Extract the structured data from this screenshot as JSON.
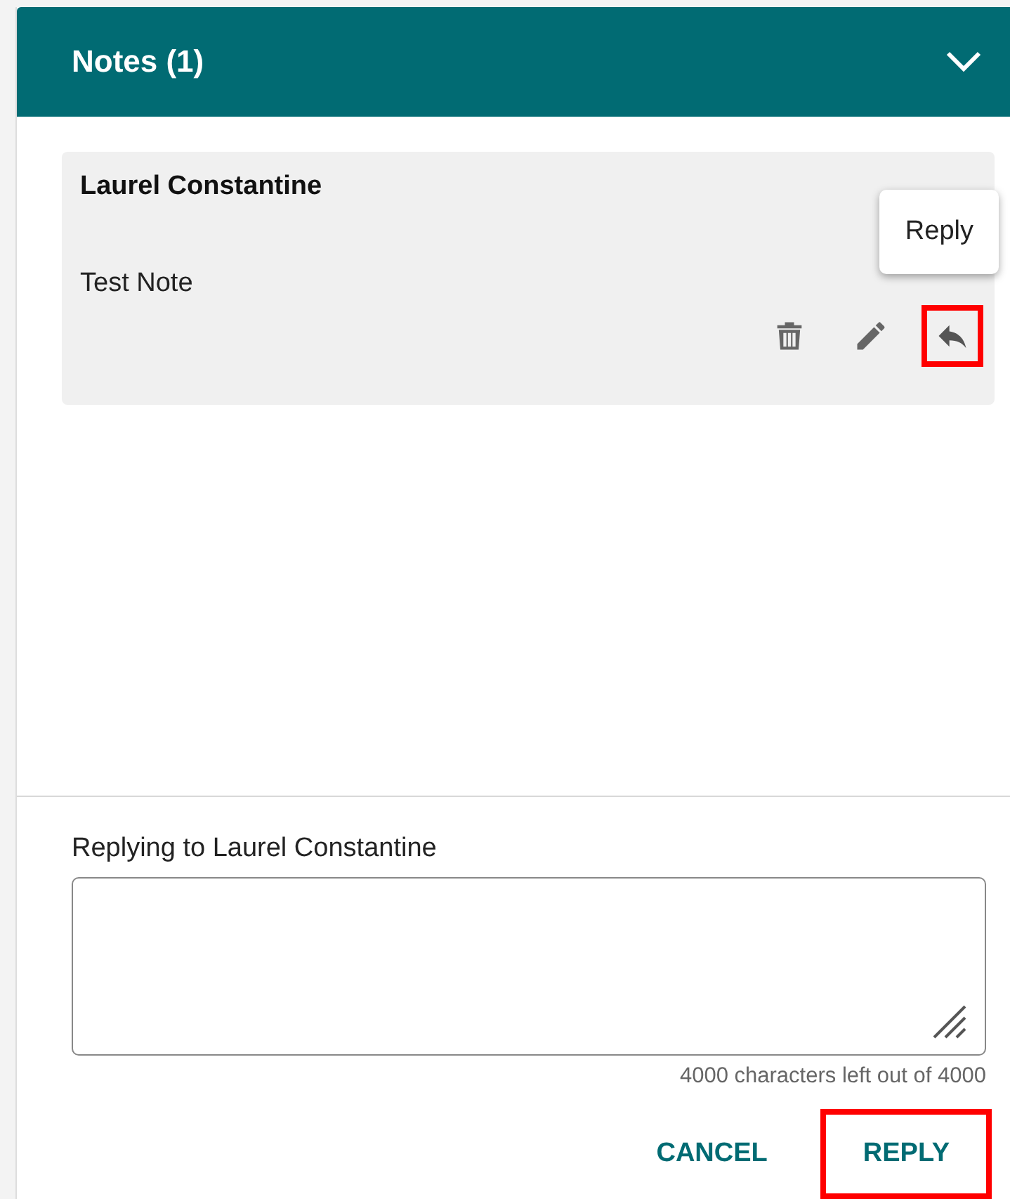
{
  "panel": {
    "title": "Notes (1)",
    "expanded": true
  },
  "notes": [
    {
      "author": "Laurel Constantine",
      "text": "Test Note",
      "actions": [
        {
          "kind": "delete",
          "highlighted": false
        },
        {
          "kind": "edit",
          "highlighted": false
        },
        {
          "kind": "reply",
          "highlighted": true,
          "tooltip": "Reply"
        }
      ]
    }
  ],
  "reply_form": {
    "label": "Replying to Laurel Constantine",
    "counter": "4000 characters left out of 4000"
  },
  "buttons": [
    {
      "label": "CANCEL",
      "highlighted": false
    },
    {
      "label": "REPLY",
      "highlighted": true
    }
  ]
}
